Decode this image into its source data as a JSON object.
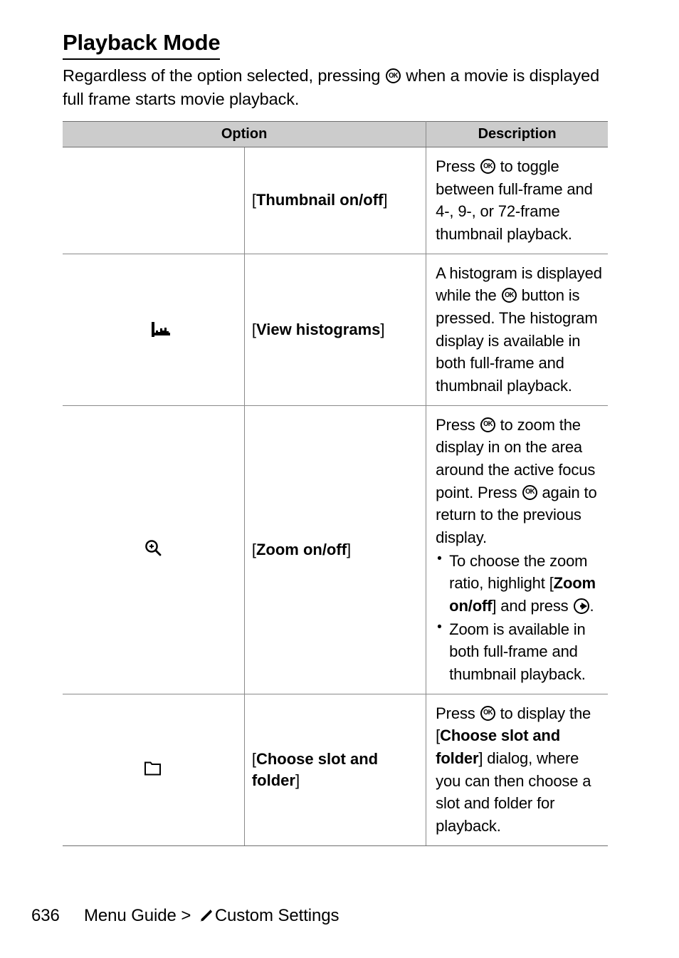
{
  "document": {
    "title": "Playback Mode",
    "intro_before_ok": "Regardless of the option selected, pressing ",
    "intro_after_ok": " when a movie is displayed full frame starts movie playback."
  },
  "table": {
    "headers": {
      "option": "Option",
      "description": "Description"
    },
    "rows": [
      {
        "icon": "thumbnail-grid-icon",
        "name_open_bracket": "[",
        "name": "Thumbnail on/off",
        "name_close_bracket": "]",
        "desc_parts": {
          "p1": "Press ",
          "p2": " to toggle between full-frame and 4-, 9-, or 72-frame thumbnail playback."
        }
      },
      {
        "icon": "histogram-icon",
        "name_open_bracket": "[",
        "name": "View histograms",
        "name_close_bracket": "]",
        "desc_parts": {
          "p1": "A histogram is displayed while the ",
          "p2": " button is pressed. The histogram display is available in both full-frame and thumbnail playback."
        }
      },
      {
        "icon": "zoom-magnifier-icon",
        "name_open_bracket": "[",
        "name": "Zoom on/off",
        "name_close_bracket": "]",
        "desc_parts": {
          "p1": "Press ",
          "p2": " to zoom the display in on the area around the active focus point. Press ",
          "p3": " again to return to the previous display."
        },
        "bullets": [
          {
            "b1": "To choose the zoom ratio, highlight [",
            "b_bold": "Zoom on/off",
            "b2": "] and press ",
            "b3": "."
          },
          {
            "b1": "Zoom is available in both full-frame and thumbnail playback."
          }
        ]
      },
      {
        "icon": "folder-icon",
        "name_open_bracket": "[",
        "name": "Choose slot and folder",
        "name_close_bracket": "]",
        "desc_parts": {
          "p1": "Press ",
          "p2": " to display the [",
          "p_bold": "Choose slot and folder",
          "p3": "] dialog, where you can then choose a slot and folder for playback."
        }
      }
    ]
  },
  "footer": {
    "page_number": "636",
    "breadcrumb_before_icon": "Menu Guide > ",
    "pencil_icon": "pencil-icon",
    "breadcrumb_after_icon": "Custom Settings"
  },
  "colors": {
    "page_background": "#ffffff",
    "text": "#000000",
    "table_header_background": "#cccccc",
    "table_border": "#8a8a8a",
    "table_outer_border": "#6f6f6f"
  }
}
